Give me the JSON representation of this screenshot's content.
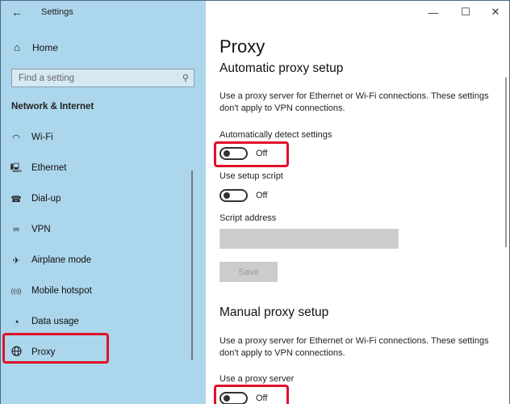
{
  "window": {
    "title": "Settings",
    "controls": {
      "minimize": "—",
      "maximize": "☐",
      "close": "✕"
    }
  },
  "sidebar": {
    "back_icon": "←",
    "home": {
      "icon": "⌂",
      "label": "Home"
    },
    "search": {
      "placeholder": "Find a setting",
      "value": "",
      "icon": "⚲"
    },
    "section_heading": "Network & Internet",
    "items": [
      {
        "icon": "wifi-icon",
        "glyph": "◠",
        "label": "Wi-Fi"
      },
      {
        "icon": "ethernet-icon",
        "glyph": "🖳",
        "label": "Ethernet"
      },
      {
        "icon": "dialup-icon",
        "glyph": "☎",
        "label": "Dial-up"
      },
      {
        "icon": "vpn-icon",
        "glyph": "∞",
        "label": "VPN"
      },
      {
        "icon": "airplane-icon",
        "glyph": "✈",
        "label": "Airplane mode"
      },
      {
        "icon": "hotspot-icon",
        "glyph": "((ı))",
        "label": "Mobile hotspot"
      },
      {
        "icon": "data-usage-icon",
        "glyph": "◔",
        "label": "Data usage"
      },
      {
        "icon": "globe-icon",
        "glyph": "🌐",
        "label": "Proxy"
      }
    ],
    "selected": "Proxy"
  },
  "content": {
    "page_title": "Proxy",
    "automatic": {
      "heading": "Automatic proxy setup",
      "description": "Use a proxy server for Ethernet or Wi-Fi connections. These settings don't apply to VPN connections.",
      "auto_detect": {
        "label": "Automatically detect settings",
        "state": "Off",
        "on": false
      },
      "setup_script": {
        "label": "Use setup script",
        "state": "Off",
        "on": false
      },
      "script_address": {
        "label": "Script address",
        "value": ""
      },
      "save_label": "Save"
    },
    "manual": {
      "heading": "Manual proxy setup",
      "description": "Use a proxy server for Ethernet or Wi-Fi connections. These settings don't apply to VPN connections.",
      "use_proxy": {
        "label": "Use a proxy server",
        "state": "Off",
        "on": false
      }
    }
  },
  "annotations": {
    "highlight_color": "#e0102a"
  }
}
